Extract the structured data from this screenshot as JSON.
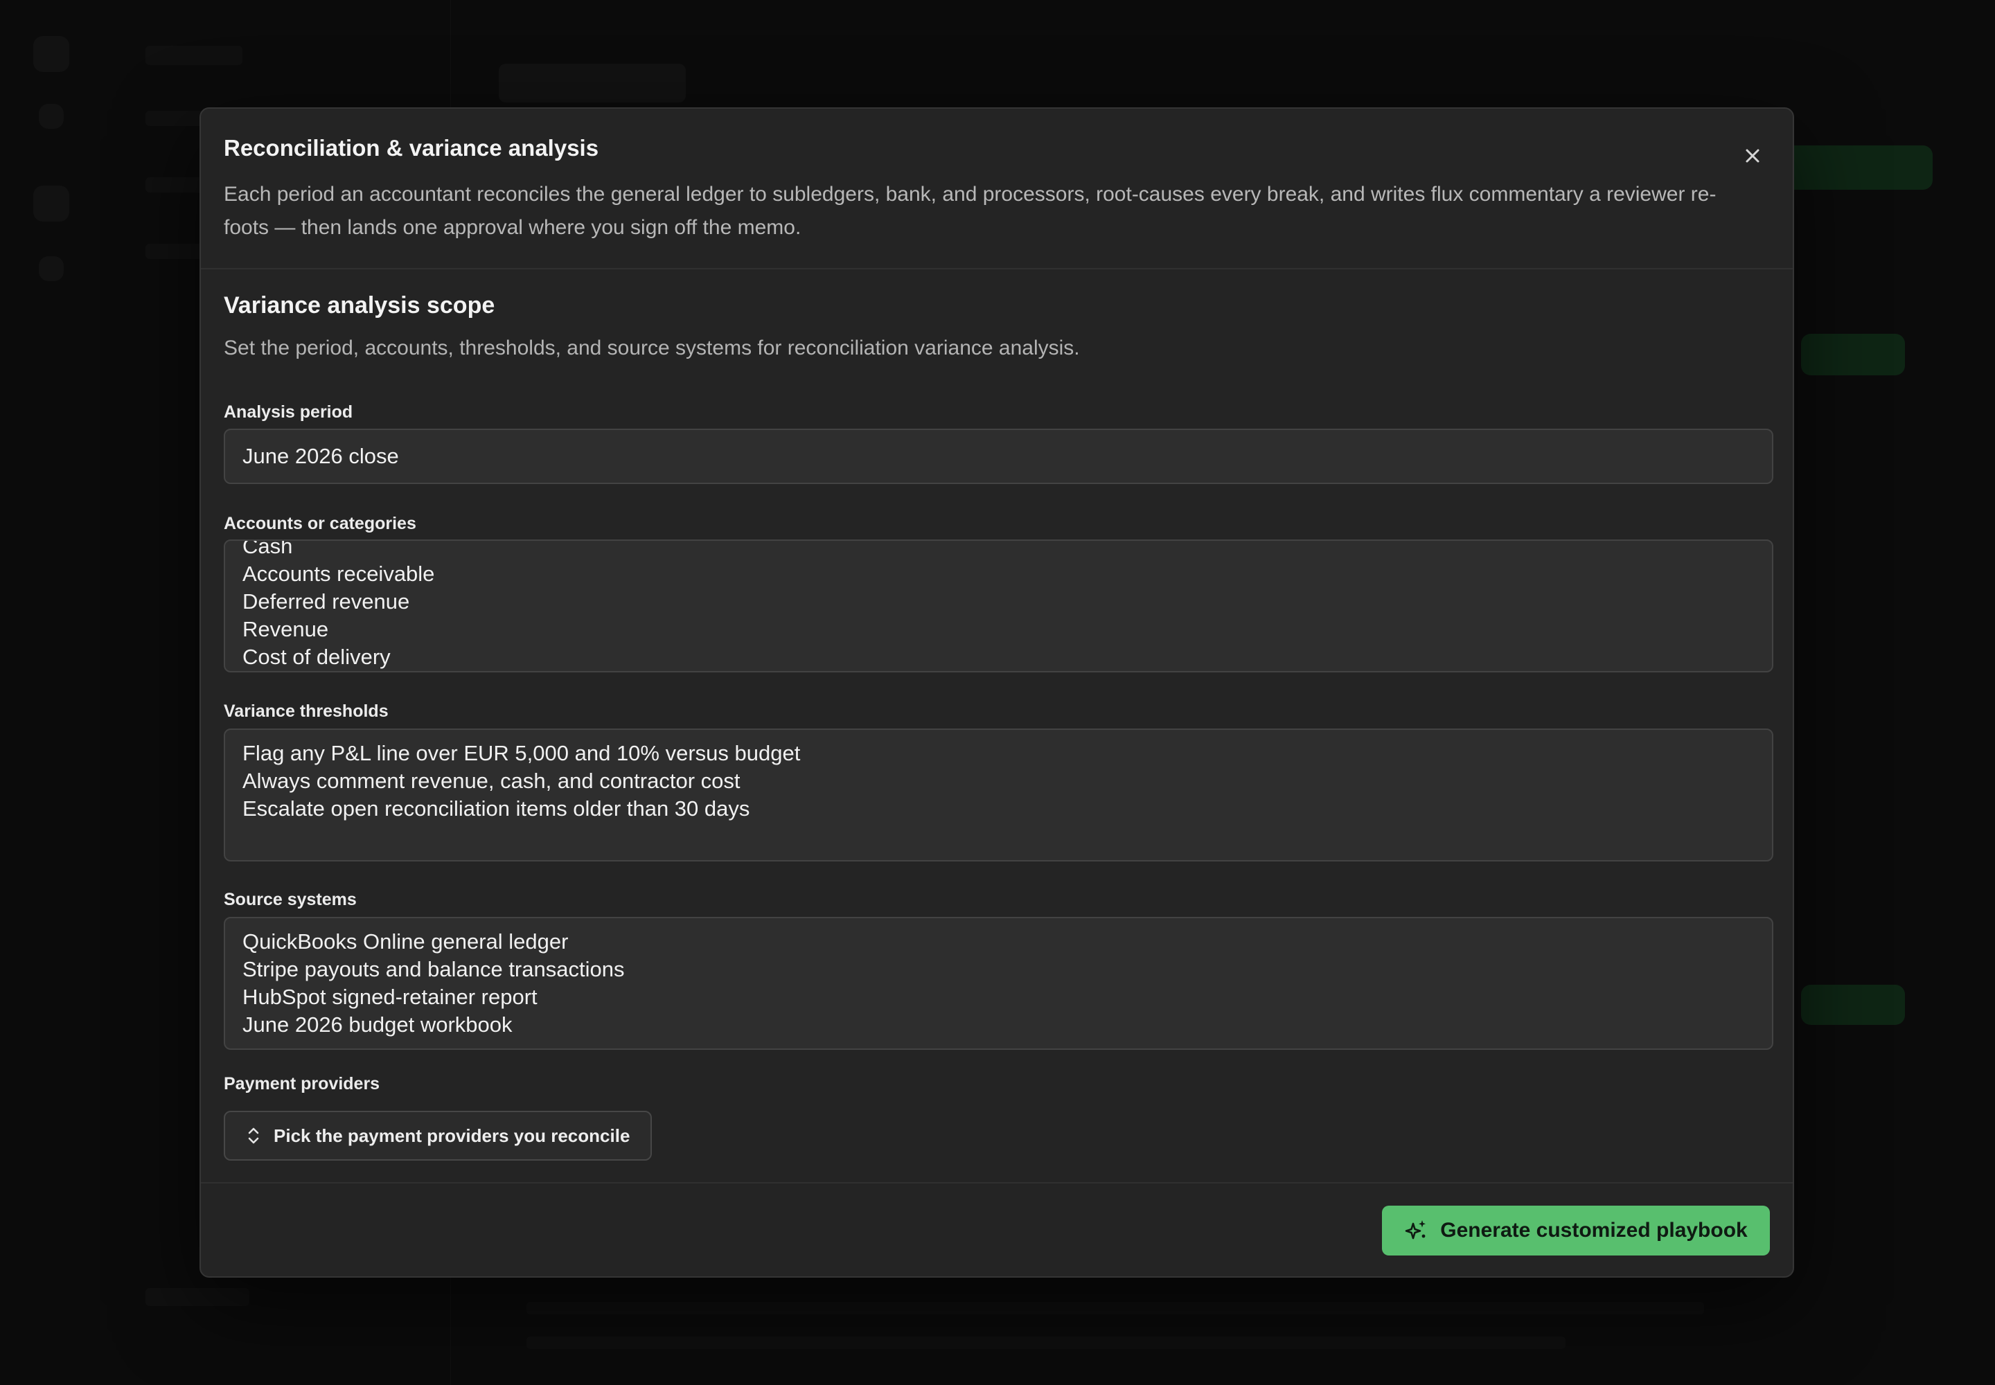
{
  "modal": {
    "title": "Reconciliation & variance analysis",
    "description": "Each period an accountant reconciles the general ledger to subledgers, bank, and processors, root-causes every break, and writes flux commentary a reviewer re-foots — then lands one approval where you sign off the memo.",
    "close_icon": "close-icon"
  },
  "scope": {
    "title": "Variance analysis scope",
    "description": "Set the period, accounts, thresholds, and source systems for reconciliation variance analysis."
  },
  "fields": {
    "analysis_period": {
      "label": "Analysis period",
      "value": "June 2026 close"
    },
    "accounts": {
      "label": "Accounts or categories",
      "lines": [
        "Cash",
        "Accounts receivable",
        "Deferred revenue",
        "Revenue",
        "Cost of delivery"
      ]
    },
    "thresholds": {
      "label": "Variance thresholds",
      "lines": [
        "Flag any P&L line over EUR 5,000 and 10% versus budget",
        "Always comment revenue, cash, and contractor cost",
        "Escalate open reconciliation items older than 30 days"
      ]
    },
    "sources": {
      "label": "Source systems",
      "lines": [
        "QuickBooks Online general ledger",
        "Stripe payouts and balance transactions",
        "HubSpot signed-retainer report",
        "June 2026 budget workbook"
      ]
    },
    "providers": {
      "label": "Payment providers",
      "button_label": "Pick the payment providers you reconcile",
      "icon": "chevron-up-down-icon"
    }
  },
  "footer": {
    "generate_label": "Generate customized playbook",
    "generate_icon": "sparkles-icon",
    "accent": "#58bf6e"
  }
}
